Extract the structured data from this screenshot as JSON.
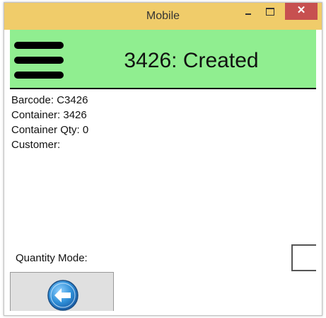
{
  "window": {
    "title": "Mobile",
    "close_glyph": "✕"
  },
  "header": {
    "title": "3426: Created",
    "menu_icon": "hamburger-icon"
  },
  "info": {
    "barcode": "Barcode: C3426",
    "container": "Container: 3426",
    "container_qty": "Container Qty: 0",
    "customer": "Customer:"
  },
  "quantity_mode": {
    "label": "Quantity Mode:",
    "checked": false
  },
  "back_button": {
    "icon": "back-arrow-icon"
  },
  "colors": {
    "titlebar": "#f0cc6a",
    "header_bg": "#90ee90",
    "close_button": "#c75050",
    "back_icon": "#2f8fd8"
  }
}
